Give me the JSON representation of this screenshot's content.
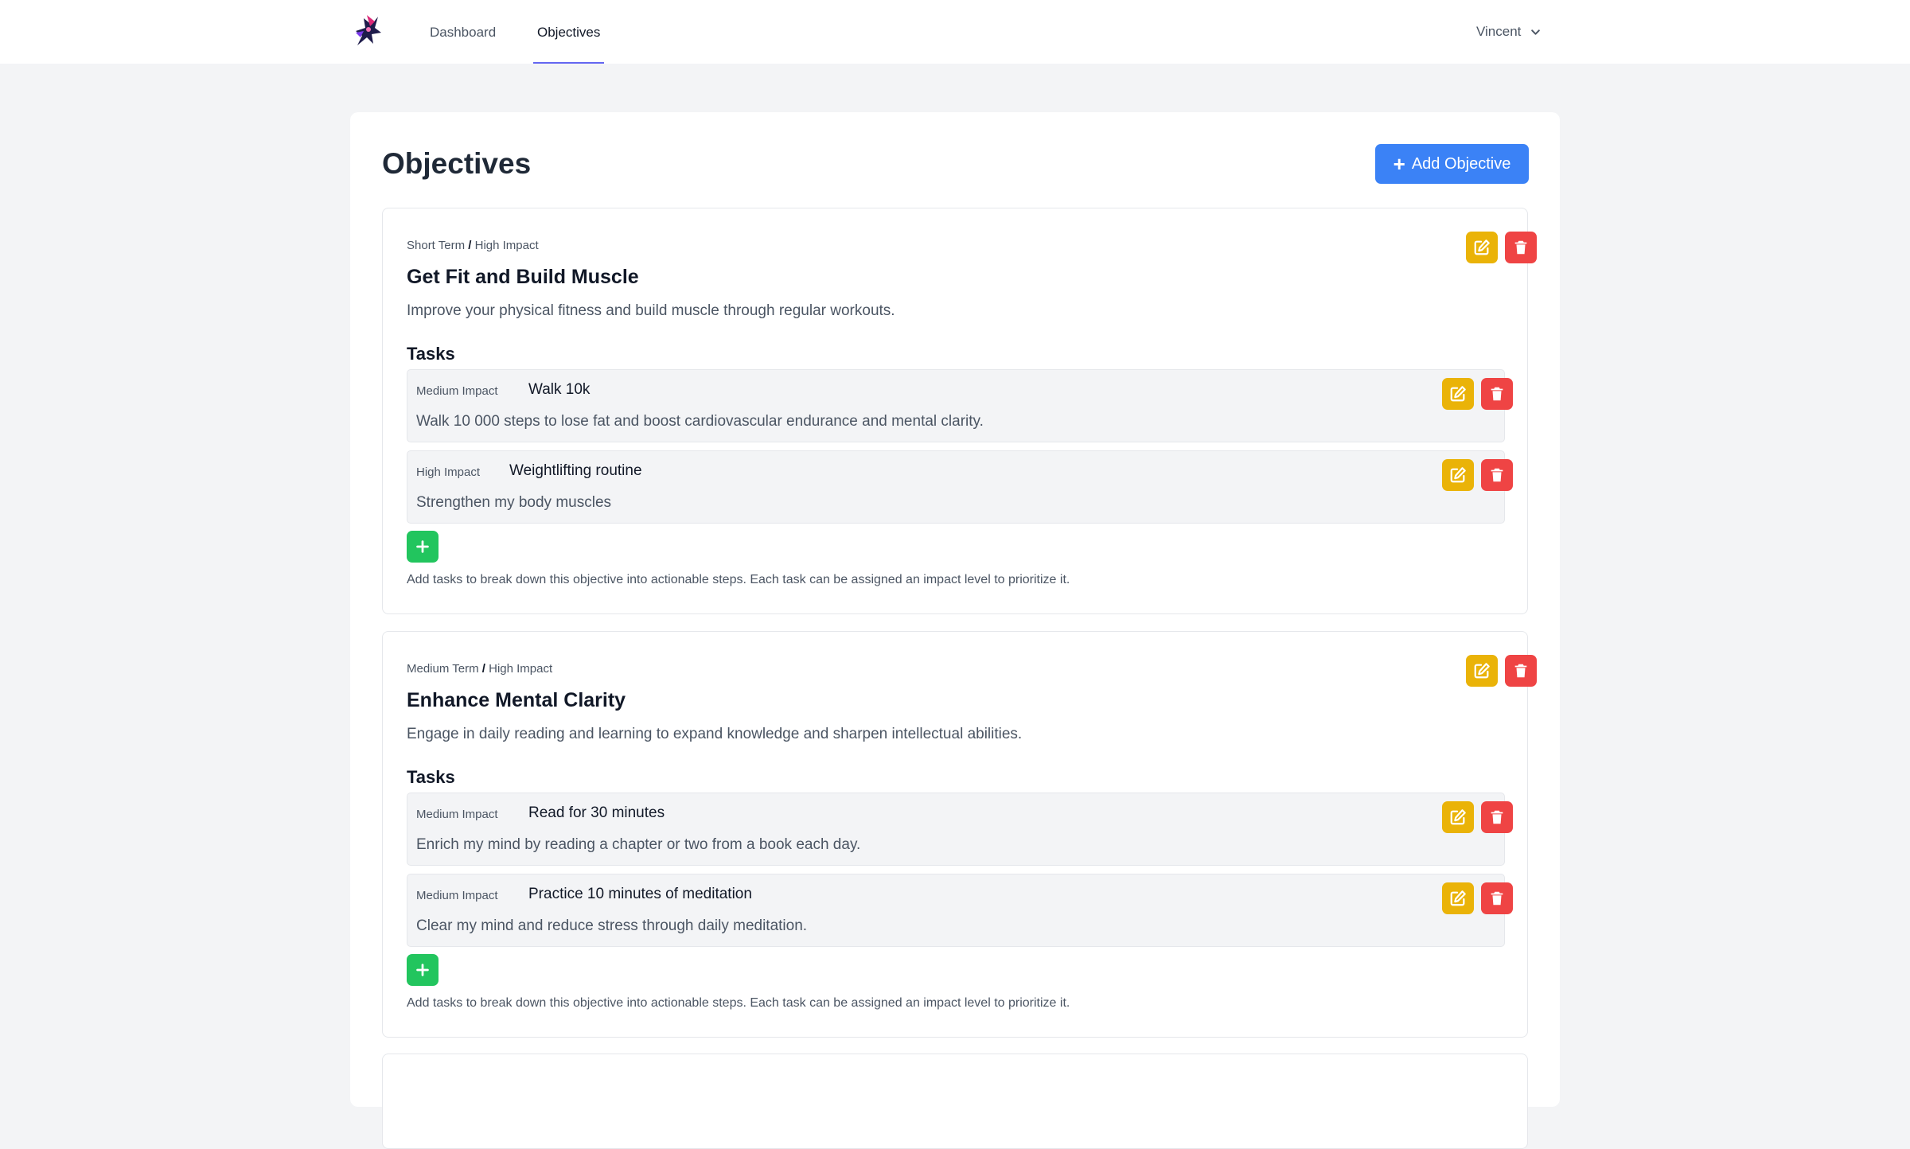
{
  "nav": {
    "items": [
      {
        "label": "Dashboard"
      },
      {
        "label": "Objectives"
      }
    ],
    "user": "Vincent"
  },
  "page": {
    "title": "Objectives",
    "add_objective_label": "Add Objective"
  },
  "objectives": [
    {
      "term": "Short Term",
      "impact": "High Impact",
      "title": "Get Fit and Build Muscle",
      "description": "Improve your physical fitness and build muscle through regular workouts.",
      "tasks_heading": "Tasks",
      "tasks": [
        {
          "impact": "Medium Impact",
          "title": "Walk 10k",
          "description": "Walk 10 000 steps to lose fat and boost cardiovascular endurance and mental clarity."
        },
        {
          "impact": "High Impact",
          "title": "Weightlifting routine",
          "description": "Strengthen my body muscles"
        }
      ],
      "helper": "Add tasks to break down this objective into actionable steps. Each task can be assigned an impact level to prioritize it."
    },
    {
      "term": "Medium Term",
      "impact": "High Impact",
      "title": "Enhance Mental Clarity",
      "description": "Engage in daily reading and learning to expand knowledge and sharpen intellectual abilities.",
      "tasks_heading": "Tasks",
      "tasks": [
        {
          "impact": "Medium Impact",
          "title": "Read for 30 minutes",
          "description": "Enrich my mind by reading a chapter or two from a book each day."
        },
        {
          "impact": "Medium Impact",
          "title": "Practice 10 minutes of meditation",
          "description": "Clear my mind and reduce stress through daily meditation."
        }
      ],
      "helper": "Add tasks to break down this objective into actionable steps. Each task can be assigned an impact level to prioritize it."
    }
  ],
  "colors": {
    "primary": "#3b82f6",
    "edit": "#eab308",
    "delete": "#ef4444",
    "add": "#22c55e",
    "nav_active": "#6366f1"
  },
  "icons": {
    "edit": "edit-icon",
    "delete": "trash-icon",
    "add": "plus-icon",
    "user_menu": "chevron-down-icon",
    "logo": "logo-icon"
  }
}
